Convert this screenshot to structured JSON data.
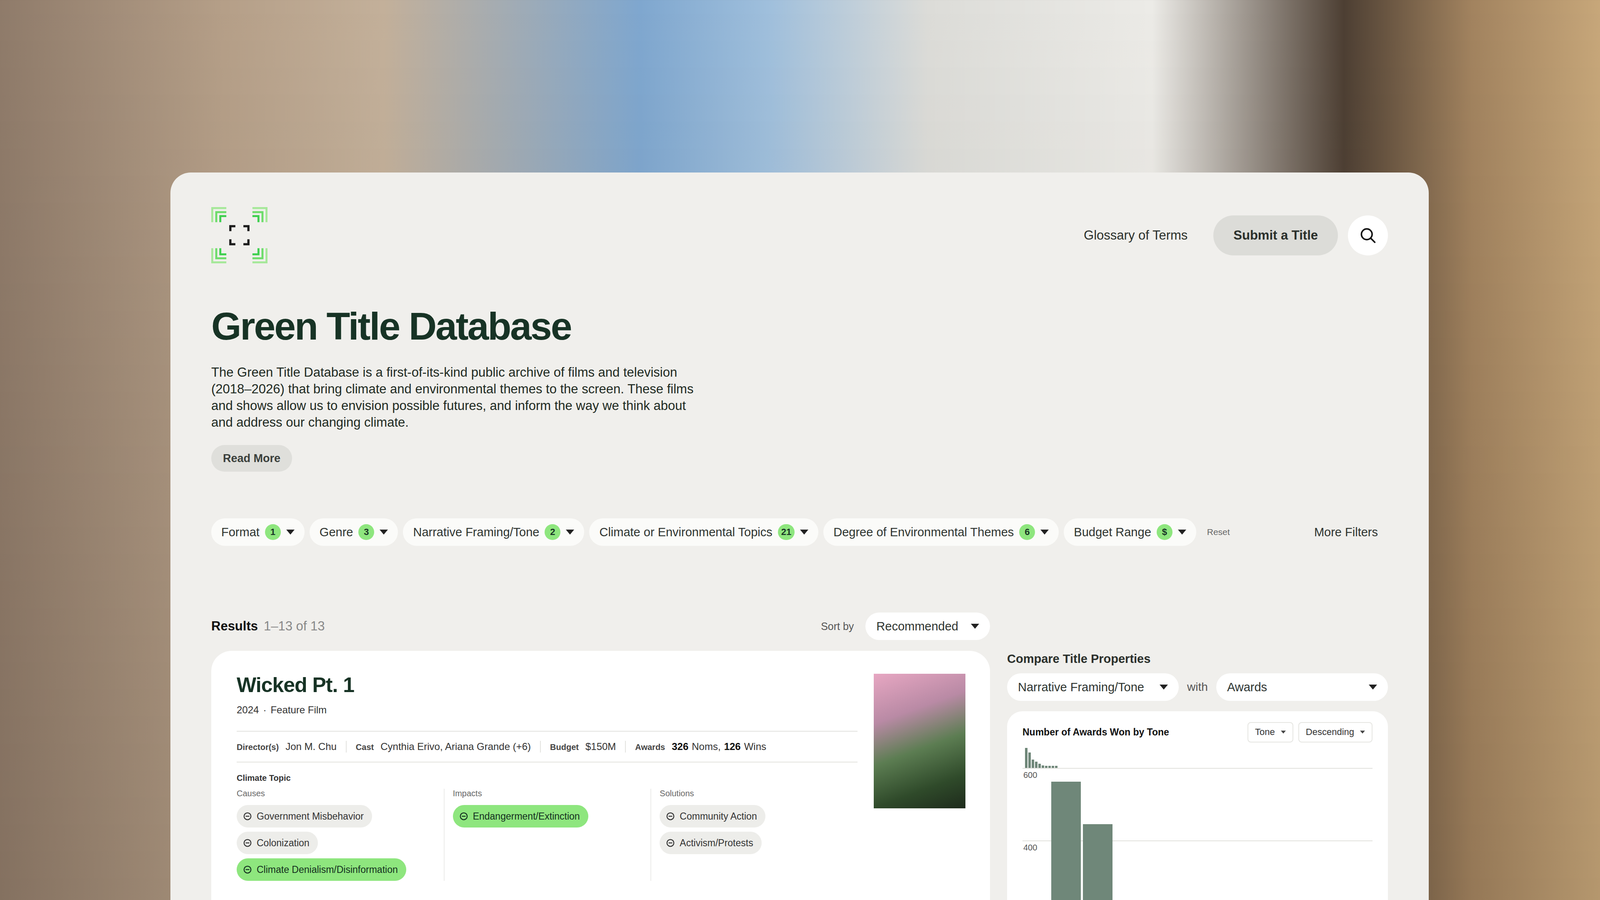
{
  "nav": {
    "links": [
      "Glossary of Terms"
    ],
    "cta": "Submit a Title"
  },
  "hero": {
    "title": "Green Title Database",
    "description": "The Green Title Database is a first-of-its-kind public archive of films and television (2018–2026) that bring climate and environmental themes to the screen. These films and shows allow us to envision possible futures, and inform the way we think about and address our changing climate.",
    "read_more": "Read More"
  },
  "filters": [
    {
      "label": "Format",
      "count": "1"
    },
    {
      "label": "Genre",
      "count": "3"
    },
    {
      "label": "Narrative Framing/Tone",
      "count": "2"
    },
    {
      "label": "Climate or Environmental Topics",
      "count": "21"
    },
    {
      "label": "Degree of Environmental Themes",
      "count": "6"
    },
    {
      "label": "Budget Range",
      "count": "$"
    }
  ],
  "reset": "Reset",
  "more_filters": "More Filters",
  "results": {
    "label": "Results",
    "range": "1–13 of 13",
    "sort_label": "Sort by",
    "sort_value": "Recommended"
  },
  "titles": [
    {
      "title": "Wicked Pt. 1",
      "year": "2024",
      "separator": "·",
      "format": "Feature Film",
      "meta": [
        {
          "label": "Director(s)",
          "segments": [
            {
              "text": "Jon M. Chu",
              "bold": false
            }
          ]
        },
        {
          "label": "Cast",
          "segments": [
            {
              "text": "Cynthia Erivo, Ariana Grande (+6)",
              "bold": false
            }
          ]
        },
        {
          "label": "Budget",
          "segments": [
            {
              "text": "$150M",
              "bold": false
            }
          ]
        },
        {
          "label": "Awards",
          "segments": [
            {
              "text": "326",
              "bold": true
            },
            {
              "text": "Noms,",
              "bold": false
            },
            {
              "text": "126",
              "bold": true
            },
            {
              "text": "Wins",
              "bold": false
            }
          ]
        }
      ],
      "topic_heading": "Climate Topic",
      "topic_columns": [
        {
          "heading": "Causes",
          "tags": [
            {
              "label": "Government Misbehavior",
              "highlighted": false
            },
            {
              "label": "Colonization",
              "highlighted": false
            },
            {
              "label": "Climate Denialism/Disinformation",
              "highlighted": true
            }
          ]
        },
        {
          "heading": "Impacts",
          "tags": [
            {
              "label": "Endangerment/Extinction",
              "highlighted": true
            }
          ]
        },
        {
          "heading": "Solutions",
          "tags": [
            {
              "label": "Community Action",
              "highlighted": false
            },
            {
              "label": "Activism/Protests",
              "highlighted": false
            }
          ]
        }
      ]
    }
  ],
  "compare": {
    "heading": "Compare Title Properties",
    "left": "Narrative Framing/Tone",
    "connector": "with",
    "right": "Awards",
    "chart": {
      "title": "Number of Awards Won by Tone",
      "group_by": "Tone",
      "order": "Descending",
      "y_ticks": [
        {
          "label": "600",
          "value": 600
        },
        {
          "label": "400",
          "value": 400
        }
      ],
      "values": [
        563,
        445
      ],
      "overview": [
        563,
        445,
        240,
        180,
        120,
        80,
        70,
        65,
        60,
        60
      ]
    }
  }
}
